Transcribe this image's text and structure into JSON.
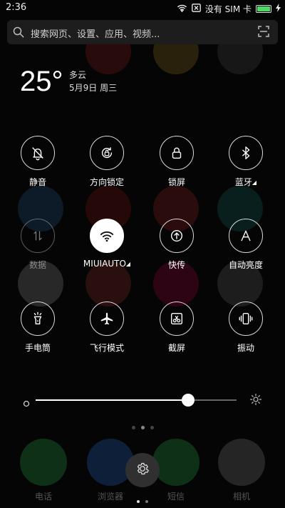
{
  "status_bar": {
    "time": "2:36",
    "carrier": "没有 SIM 卡"
  },
  "search": {
    "placeholder": "搜索网页、设置、应用、视频..."
  },
  "weather": {
    "temperature": "25°",
    "condition": "多云",
    "date": "5月9日 周三"
  },
  "toggles": [
    {
      "label": "静音",
      "icon": "bell-off-icon",
      "state": "off"
    },
    {
      "label": "方向锁定",
      "icon": "rotation-lock-icon",
      "state": "off"
    },
    {
      "label": "锁屏",
      "icon": "lock-icon",
      "state": "off"
    },
    {
      "label": "蓝牙",
      "icon": "bluetooth-icon",
      "state": "off",
      "has_menu": true
    },
    {
      "label": "数据",
      "icon": "mobile-data-icon",
      "state": "disabled"
    },
    {
      "label": "MIUIAUTO",
      "icon": "wifi-icon",
      "state": "on",
      "has_menu": true
    },
    {
      "label": "快传",
      "icon": "quick-transfer-icon",
      "state": "off"
    },
    {
      "label": "自动亮度",
      "icon": "auto-brightness-icon",
      "state": "off"
    },
    {
      "label": "手电筒",
      "icon": "flashlight-icon",
      "state": "off"
    },
    {
      "label": "飞行模式",
      "icon": "airplane-icon",
      "state": "off"
    },
    {
      "label": "截屏",
      "icon": "screenshot-icon",
      "state": "off"
    },
    {
      "label": "振动",
      "icon": "vibrate-icon",
      "state": "off"
    }
  ],
  "brightness": {
    "level": 0.76
  },
  "dock": {
    "apps": [
      "电话",
      "浏览器",
      "短信",
      "相机"
    ]
  },
  "colors": {
    "battery": "#4cd964",
    "active_toggle": "#ffffff"
  }
}
